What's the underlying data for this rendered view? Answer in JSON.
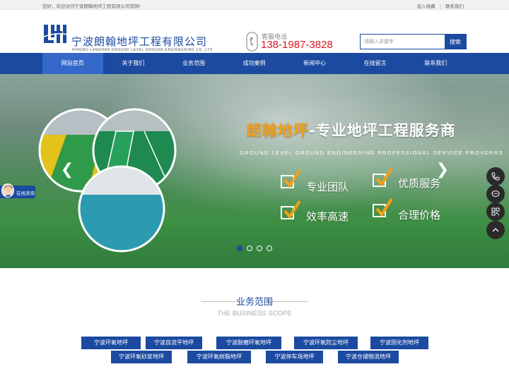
{
  "topbar": {
    "welcome": "您好，欢迎访问宁波朗翰地坪工程有限公司官网!",
    "links": [
      "加入收藏",
      "联系我们"
    ]
  },
  "header": {
    "company_cn": "宁波朗翰地坪工程有限公司",
    "company_en": "NINGBO LANGHAN GROUND LEVEL GROUND ENGINEERING CO.,LTD",
    "phone_label": "客服电话",
    "phone_number": "138-1987-3828",
    "search_placeholder": "请输入关键字",
    "search_button": "搜索"
  },
  "nav": {
    "items": [
      "网站首页",
      "关于我们",
      "业务范围",
      "成功案例",
      "新闻中心",
      "在线留言",
      "联系我们"
    ],
    "active_index": 0
  },
  "banner": {
    "title_accent": "朗翰地坪",
    "title_dash": "-",
    "title_main": "专业地坪工程服务商",
    "subtitle": "GROUND LEVEL GROUND ENGINEERING PROFESSIONAL SERVICE PROVDERS",
    "features": [
      "专业团队",
      "优质服务",
      "效率高速",
      "合理价格"
    ],
    "slide_count": 4,
    "active_slide": 0
  },
  "chat_float": {
    "label": "在线咨询"
  },
  "side_tools": [
    "phone-icon",
    "chat-icon",
    "qrcode-icon",
    "back-to-top-icon"
  ],
  "business": {
    "title": "业务范围",
    "title_en": "THE BUSINESS SCOPE",
    "tags_row1": [
      "宁波环氧地坪",
      "宁波自流平地坪",
      "宁波耐磨环氧地坪",
      "宁波环氧防尘地坪",
      "宁波固化剂地坪"
    ],
    "tags_row2": [
      "宁波环氧砂浆地坪",
      "宁波环氧树脂地坪",
      "宁波停车场地坪",
      "宁波仓储物流地坪"
    ]
  },
  "colors": {
    "brand_blue": "#1b4aa0",
    "nav_active": "#3569c9",
    "phone_red": "#e0121d",
    "accent_orange": "#f5a019"
  }
}
